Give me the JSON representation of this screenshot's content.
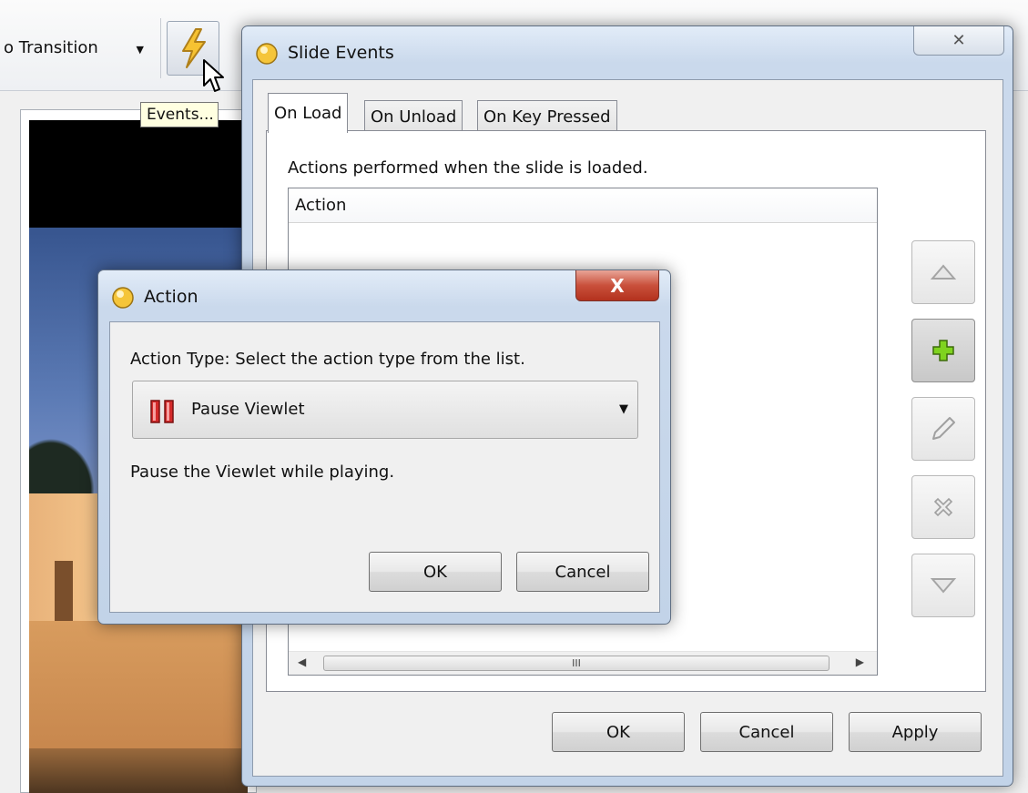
{
  "toolbar": {
    "transition_label": "o Transition",
    "events_tooltip": "Events..."
  },
  "slide_events": {
    "title": "Slide Events",
    "close_glyph": "✕",
    "tabs": [
      {
        "label": "On Load",
        "active": true
      },
      {
        "label": "On Unload",
        "active": false
      },
      {
        "label": "On Key Pressed",
        "active": false
      }
    ],
    "description": "Actions performed when the slide is loaded.",
    "table": {
      "column_header": "Action",
      "rows": [],
      "scroll_grip": "III"
    },
    "side_buttons": [
      "move-up",
      "add",
      "edit",
      "delete",
      "move-down"
    ],
    "buttons": {
      "ok": "OK",
      "cancel": "Cancel",
      "apply": "Apply"
    }
  },
  "action_dialog": {
    "title": "Action",
    "close_glyph": "X",
    "prompt": "Action Type: Select the action type from the list.",
    "selected_action": "Pause Viewlet",
    "description": "Pause the Viewlet while playing.",
    "buttons": {
      "ok": "OK",
      "cancel": "Cancel"
    }
  },
  "colors": {
    "accent_add": "#7fd31f",
    "close_red": "#c9503b",
    "pause_red": "#d42a2a",
    "tooltip_bg": "#ffffe1"
  }
}
